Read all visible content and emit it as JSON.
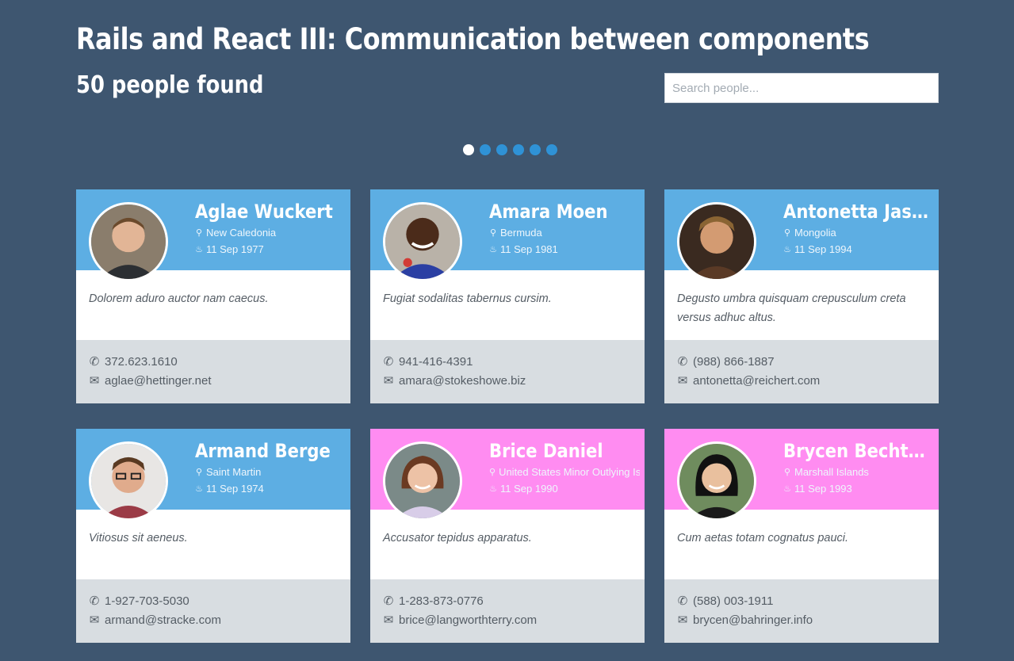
{
  "header": {
    "title": "Rails and React III: Communication between components",
    "count": "50 people found"
  },
  "search": {
    "placeholder": "Search people...",
    "value": ""
  },
  "pagination": {
    "pages": 6,
    "active": 1
  },
  "cards": [
    {
      "name": "Aglae Wuckert",
      "location": "New Caledonia",
      "birthday": "11 Sep 1977",
      "quote": "Dolorem aduro auctor nam caecus.",
      "phone": "372.623.1610",
      "email": "aglae@hettinger.net",
      "color": "#5daee3"
    },
    {
      "name": "Amara Moen",
      "location": "Bermuda",
      "birthday": "11 Sep 1981",
      "quote": "Fugiat sodalitas tabernus cursim.",
      "phone": "941-416-4391",
      "email": "amara@stokeshowe.biz",
      "color": "#5daee3"
    },
    {
      "name": "Antonetta Jaskolski",
      "location": "Mongolia",
      "birthday": "11 Sep 1994",
      "quote": "Degusto umbra quisquam crepusculum creta versus adhuc altus.",
      "phone": "(988) 866-1887",
      "email": "antonetta@reichert.com",
      "color": "#5daee3"
    },
    {
      "name": "Armand Berge",
      "location": "Saint Martin",
      "birthday": "11 Sep 1974",
      "quote": "Vitiosus sit aeneus.",
      "phone": "1-927-703-5030",
      "email": "armand@stracke.com",
      "color": "#5daee3"
    },
    {
      "name": "Brice Daniel",
      "location": "United States Minor Outlying Islands",
      "birthday": "11 Sep 1990",
      "quote": "Accusator tepidus apparatus.",
      "phone": "1-283-873-0776",
      "email": "brice@langworthterry.com",
      "color": "#ff8cf1"
    },
    {
      "name": "Brycen Bechtelar",
      "location": "Marshall Islands",
      "birthday": "11 Sep 1993",
      "quote": "Cum aetas totam cognatus pauci.",
      "phone": "(588) 003-1911",
      "email": "brycen@bahringer.info",
      "color": "#ff8cf1"
    }
  ],
  "icons": {
    "location": "map-marker-icon",
    "birthday": "birthday-cake-icon",
    "phone": "phone-icon",
    "email": "envelope-icon"
  }
}
